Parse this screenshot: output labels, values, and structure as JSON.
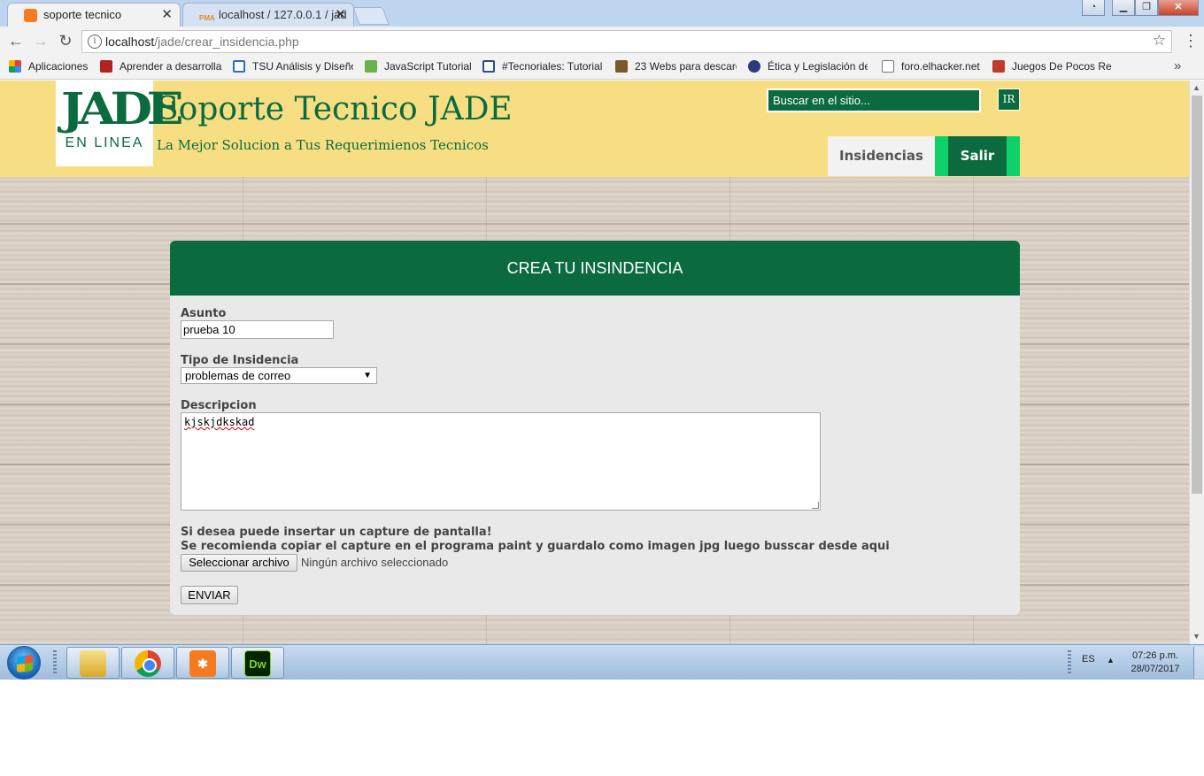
{
  "browser": {
    "tabs": [
      {
        "title": "soporte tecnico",
        "active": true,
        "icon": "xampp-icon"
      },
      {
        "title": "localhost / 127.0.0.1 / jad",
        "active": false,
        "icon": "phpmyadmin-icon"
      }
    ],
    "url_host": "localhost",
    "url_path": "/jade/crear_insidencia.php",
    "bookmarks": [
      {
        "label": "Aplicaciones",
        "icon": "apps-grid-icon"
      },
      {
        "label": "Aprender a desarrolla",
        "icon": "book-icon"
      },
      {
        "label": "TSU Análisis y Diseño",
        "icon": "window-icon"
      },
      {
        "label": "JavaScript Tutorial",
        "icon": "w3schools-icon"
      },
      {
        "label": "#Tecnoriales: Tutorial",
        "icon": "monitor-icon"
      },
      {
        "label": "23 Webs para descarg",
        "icon": "cube-icon"
      },
      {
        "label": "Ética y Legislación de",
        "icon": "figure-icon"
      },
      {
        "label": "foro.elhacker.net",
        "icon": "page-icon"
      },
      {
        "label": "Juegos De Pocos Req",
        "icon": "game-icon"
      }
    ]
  },
  "site": {
    "logo_mark": "JADE",
    "logo_sub": "EN LINEA",
    "title": "Soporte Tecnico JADE",
    "tagline": "La Mejor Solucion a Tus Requerimienos Tecnicos",
    "search_placeholder": "Buscar en el sitio...",
    "search_button": "IR",
    "nav": {
      "insidencias": "Insidencias",
      "salir": "Salir"
    }
  },
  "form": {
    "heading": "CREA TU INSINDENCIA",
    "asunto_label": "Asunto",
    "asunto_value": "prueba 10",
    "tipo_label": "Tipo de Insidencia",
    "tipo_value": "problemas de correo",
    "descripcion_label": "Descripcion",
    "descripcion_value": "kjskjdkskad",
    "note_line1": "Si desea puede insertar un capture de pantalla!",
    "note_line2": "Se recomienda copiar el capture en el programa paint y guardalo como imagen jpg luego busscar desde aqui",
    "file_button": "Seleccionar archivo",
    "file_status": "Ningún archivo seleccionado",
    "submit": "ENVIAR"
  },
  "taskbar": {
    "apps": [
      "file-explorer-icon",
      "chrome-icon",
      "xampp-icon",
      "dreamweaver-icon"
    ],
    "dw_label": "Dw",
    "language": "ES",
    "time": "07:26 p.m.",
    "date": "28/07/2017"
  },
  "colors": {
    "header_bg": "#f7de82",
    "brand_green": "#0b6b3f",
    "accent_green": "#0fd16a",
    "card_bg": "#e9e9e9"
  }
}
